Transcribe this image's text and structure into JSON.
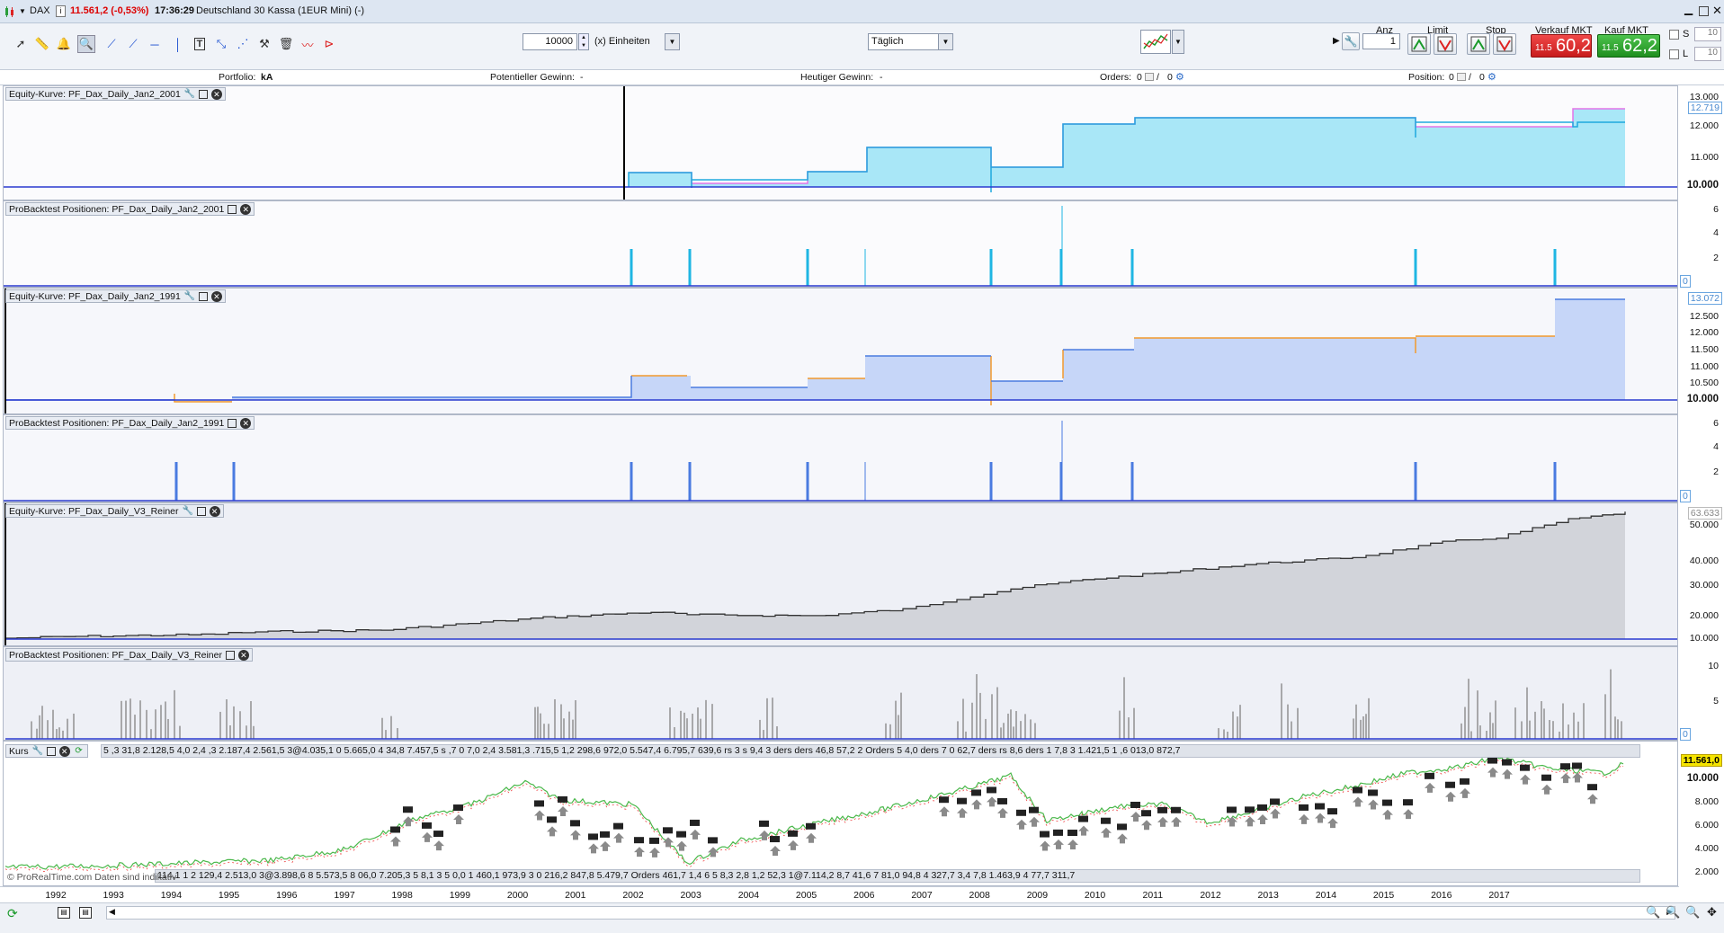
{
  "title_bar": {
    "symbol": "DAX",
    "price_change": "11.561,2 (-0,53%)",
    "time": "17:36:29",
    "instrument": "Deutschland 30 Kassa (1EUR Mini) (-)"
  },
  "toolbar": {
    "quantity": "10000",
    "unit_label": "(x) Einheiten",
    "period": "Täglich",
    "anz_label": "Anz",
    "anz_value": "1",
    "limit_label": "Limit",
    "stop_label": "Stop",
    "sell_label": "Verkauf MKT",
    "sell_prefix": "11.5",
    "sell_big": "60,2",
    "buy_label": "Kauf MKT",
    "buy_prefix": "11.5",
    "buy_big": "62,2",
    "s_label": "S",
    "l_label": "L",
    "s_value": "10",
    "l_value": "10"
  },
  "info_bar": {
    "portfolio_label": "Portfolio:",
    "portfolio_value": "kA",
    "pot_gain_label": "Potentieller Gewinn:",
    "pot_gain_value": "-",
    "today_gain_label": "Heutiger Gewinn:",
    "today_gain_value": "-",
    "orders_label": "Orders:",
    "orders_a": "0",
    "orders_b": "0",
    "position_label": "Position:",
    "position_a": "0",
    "position_b": "0"
  },
  "panels": {
    "eq2001": {
      "label": "Equity-Kurve: PF_Dax_Daily_Jan2_2001",
      "current": "12.719",
      "ticks": [
        "13.000",
        "12.000",
        "11.000",
        "10.000"
      ]
    },
    "pos2001": {
      "label": "ProBacktest Positionen: PF_Dax_Daily_Jan2_2001",
      "current": "0",
      "ticks": [
        "6",
        "4",
        "2",
        "0"
      ]
    },
    "eq1991": {
      "label": "Equity-Kurve: PF_Dax_Daily_Jan2_1991",
      "current": "13.072",
      "ticks": [
        "12.500",
        "12.000",
        "11.500",
        "11.000",
        "10.500",
        "10.000"
      ]
    },
    "pos1991": {
      "label": "ProBacktest Positionen: PF_Dax_Daily_Jan2_1991",
      "current": "0",
      "ticks": [
        "6",
        "4",
        "2",
        "0"
      ]
    },
    "eqV3": {
      "label": "Equity-Kurve: PF_Dax_Daily_V3_Reiner",
      "current": "63.633",
      "ticks": [
        "50.000",
        "40.000",
        "30.000",
        "20.000",
        "10.000"
      ]
    },
    "posV3": {
      "label": "ProBacktest Positionen: PF_Dax_Daily_V3_Reiner",
      "current": "0",
      "ticks": [
        "10",
        "5",
        "0"
      ]
    },
    "kurs": {
      "label": "Kurs",
      "current": "11.561,0",
      "ticks": [
        "10.000",
        "8.000",
        "6.000",
        "4.000",
        "2.000"
      ],
      "watermark": "© ProRealTime.com Daten sind indikativ"
    }
  },
  "top_orders": "5 ,3 31,8 2.128,5 4,0 2,4 ,3 2.187,4 2.561,5 3@4.035,1 0 5.665,0 4 34,8 7.457,5 s ,7 0 7,0 2,4 3.581,3 .715,5 1,2 298,6 972,0 5.547,4 6.795,7 639,6 rs 3 s 9,4 3 ders ders 46,8 57,2 2 Orders 5 4,0 ders 7 0 62,7 ders rs 8,6 ders 1 7,8 3 1.421,5 1 ,6 013,0 872,7",
  "bottom_orders": "114,1 1 2 129,4 2.513,0 3@3.898,6 8 5.573,5 8 06,0 7.205,3 5 8,1 3 5 0,0 1 460,1 973,9 3 0 216,2 847,8 5.479,7 Orders 461,7 1,4 6 5 8,3 2,8 1,2 52,3 1@7.114,2 8,7 41,6 7 81,0 94,8 4 327,7 3,4 7,8 1.463,9 4 77,7 311,7",
  "years": [
    "1992",
    "1993",
    "1994",
    "1995",
    "1996",
    "1997",
    "1998",
    "1999",
    "2000",
    "2001",
    "2002",
    "2003",
    "2004",
    "2005",
    "2006",
    "2007",
    "2008",
    "2009",
    "2010",
    "2011",
    "2012",
    "2013",
    "2014",
    "2015",
    "2016",
    "2017"
  ]
}
